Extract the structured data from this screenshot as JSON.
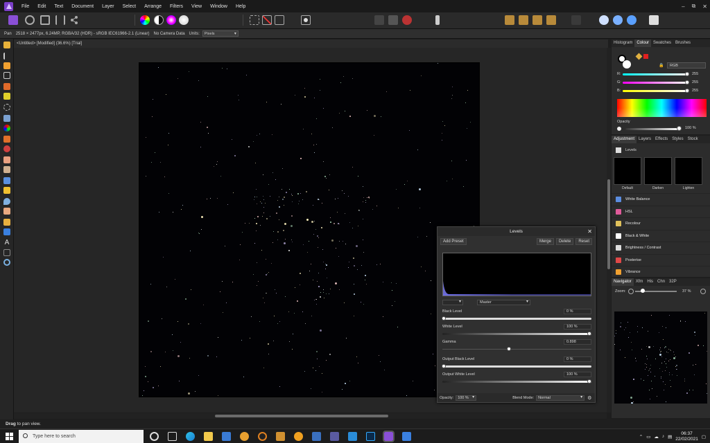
{
  "menu": [
    "File",
    "Edit",
    "Text",
    "Document",
    "Layer",
    "Select",
    "Arrange",
    "Filters",
    "View",
    "Window",
    "Help"
  ],
  "window_controls": [
    "–",
    "⧉",
    "✕"
  ],
  "context": {
    "tool": "Pan",
    "info": "2518 × 2477px, 6.24MP, RGBA/32 (HDR) - sRGB IEC61966-2.1 (Linear)",
    "camera": "No Camera Data",
    "units_label": "Units:",
    "units_value": "Pixels"
  },
  "doc_tab": "<Untitled> [Modified] (36.6%) [Trial]",
  "status": {
    "bold": "Drag",
    "rest": " to pan view."
  },
  "colour_panel": {
    "tabs": [
      "Histogram",
      "Colour",
      "Swatches",
      "Brushes"
    ],
    "active_tab": "Colour",
    "mode": "RGB",
    "r_label": "R:",
    "r_value": "255",
    "g_label": "G:",
    "g_value": "255",
    "b_label": "B:",
    "b_value": "255",
    "opacity_label": "Opacity",
    "opacity_value": "100 %"
  },
  "adjustment_panel": {
    "tabs": [
      "Adjustment",
      "Layers",
      "Effects",
      "Styles",
      "Stock"
    ],
    "active_tab": "Adjustment",
    "section": "Levels",
    "presets": [
      "Default",
      "Darken",
      "Lighten"
    ],
    "items": [
      {
        "label": "White Balance",
        "color": "#5b8de0"
      },
      {
        "label": "HSL",
        "color": "#e05b9b"
      },
      {
        "label": "Recolour",
        "color": "#e0c15b"
      },
      {
        "label": "Black & White",
        "color": "#ffffff"
      },
      {
        "label": "Brightness / Contrast",
        "color": "#dddddd"
      },
      {
        "label": "Posterise",
        "color": "#e04848"
      },
      {
        "label": "Vibrance",
        "color": "#f0a030"
      }
    ]
  },
  "navigator_panel": {
    "tabs": [
      "Navigator",
      "Xfm",
      "His",
      "Chn",
      "32P"
    ],
    "active_tab": "Navigator",
    "zoom_label": "Zoom:",
    "zoom_value": "37 %"
  },
  "levels_dialog": {
    "title": "Levels",
    "add_preset": "Add Preset",
    "merge": "Merge",
    "delete": "Delete",
    "reset": "Reset",
    "channel": "Master",
    "black_level_label": "Black Level",
    "black_level_value": "0 %",
    "white_level_label": "White Level",
    "white_level_value": "100 %",
    "gamma_label": "Gamma",
    "gamma_value": "0.898",
    "out_black_label": "Output Black Level",
    "out_black_value": "0 %",
    "out_white_label": "Output White Level",
    "out_white_value": "100 %",
    "opacity_label": "Opacity:",
    "opacity_value": "100 %",
    "blend_label": "Blend Mode:",
    "blend_value": "Normal"
  },
  "taskbar": {
    "search_placeholder": "Type here to search",
    "time": "06:37",
    "date": "22/02/2021"
  }
}
